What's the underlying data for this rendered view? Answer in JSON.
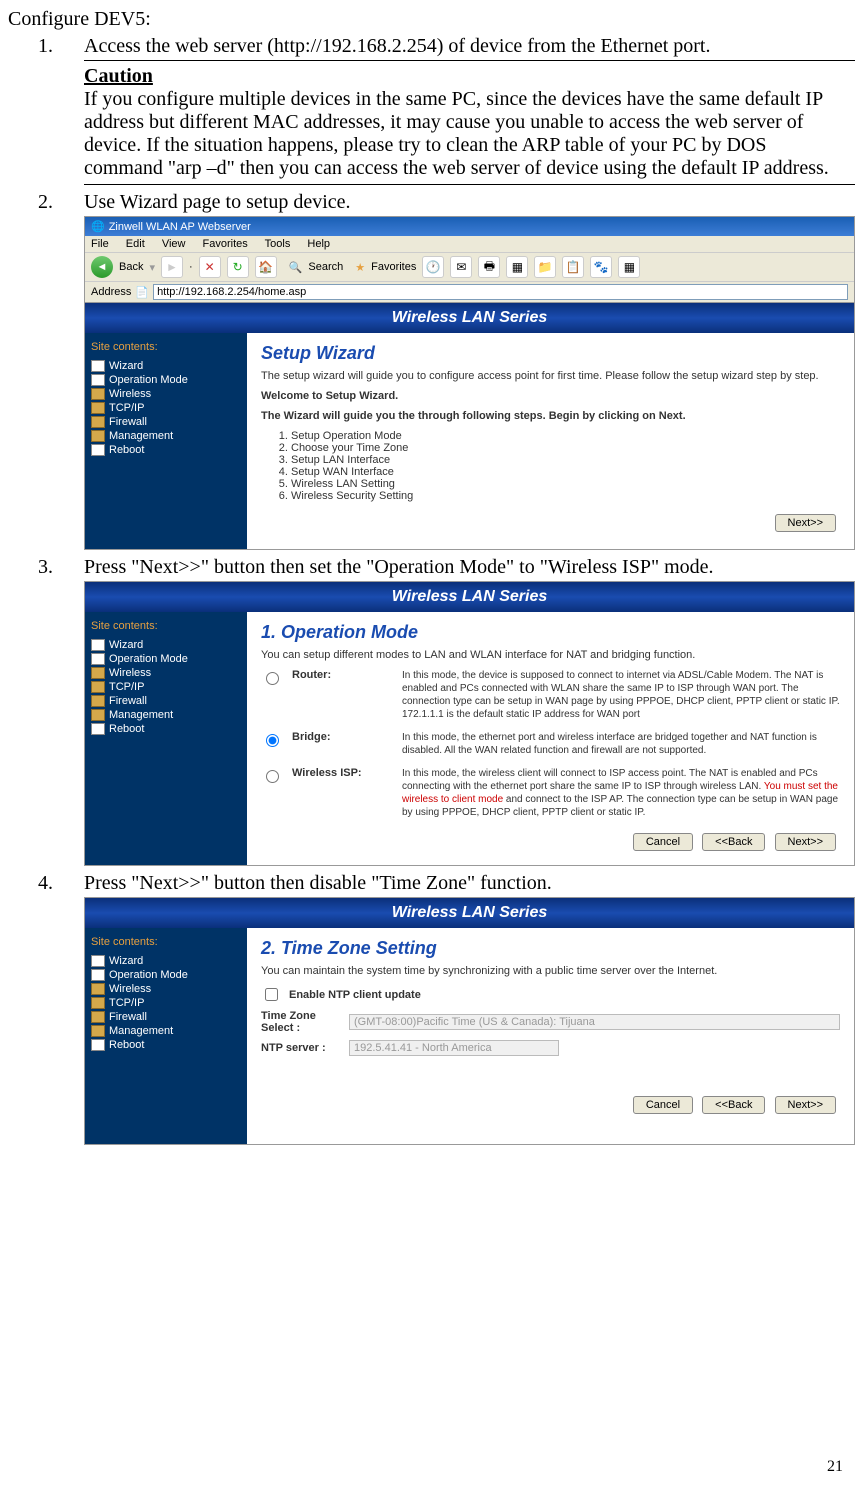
{
  "title": "Configure DEV5:",
  "step1": {
    "num": "1.",
    "text": "Access the web server (http://192.168.2.254) of device from the Ethernet port."
  },
  "caution": {
    "head": "Caution",
    "body": "If you configure multiple devices in the same PC, since the devices have the same default IP address but different MAC addresses, it may cause you unable to access the web server of device. If the situation happens, please try to clean the ARP table of your PC by DOS command \"arp –d\" then you can access the web server of device using the default IP address."
  },
  "step2": {
    "num": "2.",
    "text": "Use Wizard page to setup device."
  },
  "step3": {
    "num": "3.",
    "text": "Press \"Next>>\" button then set the \"Operation Mode\" to \"Wireless ISP\" mode."
  },
  "step4": {
    "num": "4.",
    "text": "Press \"Next>>\" button then disable \"Time Zone\" function."
  },
  "browser": {
    "title": "Zinwell WLAN AP Webserver",
    "menu": [
      "File",
      "Edit",
      "View",
      "Favorites",
      "Tools",
      "Help"
    ],
    "back": "Back",
    "search": "Search",
    "favorites": "Favorites",
    "addressLabel": "Address",
    "url": "http://192.168.2.254/home.asp"
  },
  "banner": "Wireless LAN Series",
  "sidebar": {
    "title": "Site contents:",
    "items": [
      "Wizard",
      "Operation Mode",
      "Wireless",
      "TCP/IP",
      "Firewall",
      "Management",
      "Reboot"
    ]
  },
  "wizard": {
    "heading": "Setup Wizard",
    "intro": "The setup wizard will guide you to configure access point for first time. Please follow the setup wizard step by step.",
    "welcome": "Welcome to Setup Wizard.",
    "guide": "The Wizard will guide you the through following steps. Begin by clicking on Next.",
    "steps": [
      "Setup Operation Mode",
      "Choose your Time Zone",
      "Setup LAN Interface",
      "Setup WAN Interface",
      "Wireless LAN Setting",
      "Wireless Security Setting"
    ]
  },
  "opmode": {
    "heading": "1. Operation Mode",
    "intro": "You can setup different modes to LAN and WLAN interface for NAT and bridging function.",
    "router": {
      "label": "Router:",
      "desc": "In this mode, the device is supposed to connect to internet via ADSL/Cable Modem. The NAT is enabled and PCs connected with WLAN share the same IP to ISP through WAN port. The connection type can be setup in WAN page by using PPPOE, DHCP client, PPTP client or static IP. 172.1.1.1 is the default static IP address for WAN port"
    },
    "bridge": {
      "label": "Bridge:",
      "desc": "In this mode, the ethernet port and wireless interface are bridged together and NAT function is disabled. All the WAN related function and firewall are not supported."
    },
    "wisp": {
      "label": "Wireless ISP:",
      "desc1": "In this mode, the wireless client will connect to ISP access point. The NAT is enabled and PCs connecting with the ethernet port share the same IP to ISP through wireless LAN. ",
      "red": "You must set the wireless to client mode",
      "desc2": " and connect to the ISP AP. The connection type can be setup in WAN page by using PPPOE, DHCP client, PPTP client or static IP."
    }
  },
  "tz": {
    "heading": "2. Time Zone Setting",
    "intro": "You can maintain the system time by synchronizing with a public time server over the Internet.",
    "enable": "Enable NTP client update",
    "zoneLabel": "Time Zone Select :",
    "zoneValue": "(GMT-08:00)Pacific Time (US & Canada): Tijuana",
    "ntpLabel": "NTP server :",
    "ntpValue": "192.5.41.41 - North America"
  },
  "buttons": {
    "next": "Next>>",
    "back": "<<Back",
    "cancel": "Cancel"
  },
  "pageNum": "21"
}
